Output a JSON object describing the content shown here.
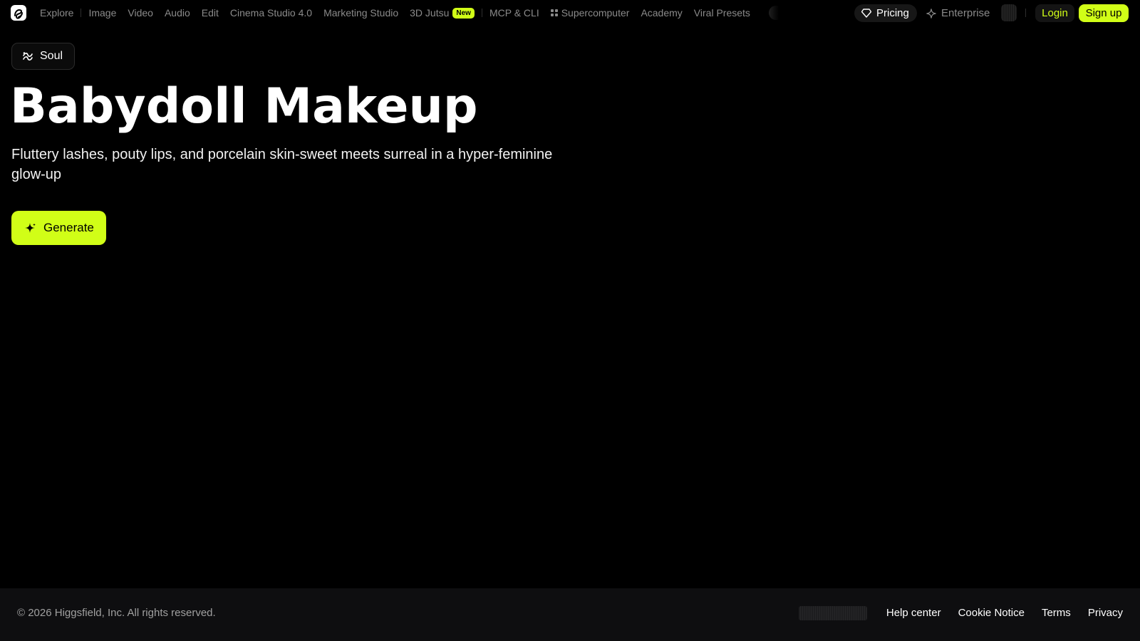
{
  "nav": {
    "logo_icon": "higgsfield-logo-icon",
    "links": [
      {
        "label": "Explore"
      },
      {
        "label": "Image"
      },
      {
        "label": "Video"
      },
      {
        "label": "Audio"
      },
      {
        "label": "Edit"
      },
      {
        "label": "Cinema Studio 4.0"
      },
      {
        "label": "Marketing Studio"
      },
      {
        "label": "3D Jutsu",
        "badge": "New"
      },
      {
        "label": "MCP & CLI"
      },
      {
        "label": "Supercomputer",
        "icon": "grid-icon"
      },
      {
        "label": "Academy"
      },
      {
        "label": "Viral Presets"
      }
    ],
    "pricing_label": "Pricing",
    "pricing_icon": "diamond-icon",
    "enterprise_label": "Enterprise",
    "enterprise_icon": "sparkle-icon",
    "login_label": "Login",
    "signup_label": "Sign up"
  },
  "hero": {
    "tag_label": "Soul",
    "tag_icon": "soul-icon",
    "title": "Babydoll Makeup",
    "subtitle": "Fluttery lashes, pouty lips, and porcelain skin-sweet meets surreal in a hyper-feminine glow-up",
    "generate_label": "Generate",
    "generate_icon": "sparkle-icon"
  },
  "footer": {
    "copyright": "© 2026 Higgsfield, Inc. All rights reserved.",
    "links": [
      "Help center",
      "Cookie Notice",
      "Terms",
      "Privacy"
    ]
  },
  "colors": {
    "background": "#000000",
    "accent": "#d1fe17",
    "muted_text": "#8a8a8a",
    "footer_bg": "#0e0e10"
  }
}
